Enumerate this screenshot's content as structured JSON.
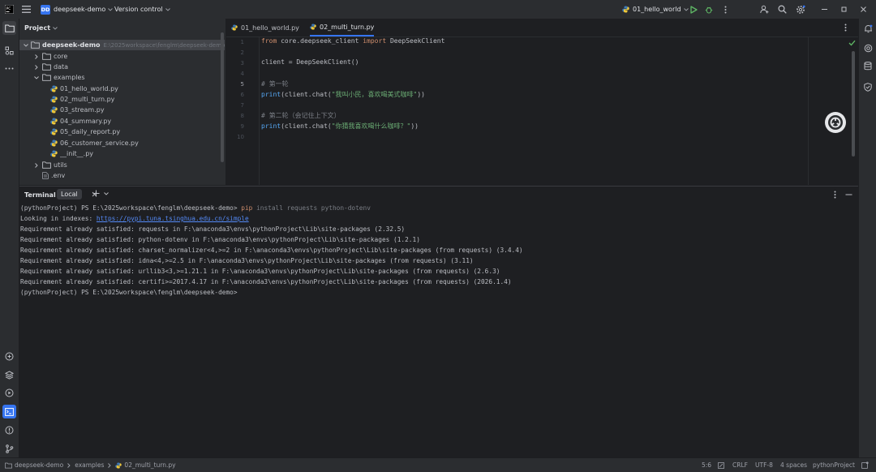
{
  "titlebar": {
    "project_badge": "DD",
    "project_name": "deepseek-demo",
    "version_control": "Version control",
    "run_config": "01_hello_world"
  },
  "project_panel": {
    "title": "Project",
    "root": {
      "name": "deepseek-demo",
      "path": "E:\\2025workspace\\fenglm\\deepseek-demo"
    },
    "items": [
      {
        "label": "core",
        "type": "folder",
        "depth": 1,
        "expanded": false
      },
      {
        "label": "data",
        "type": "folder",
        "depth": 1,
        "expanded": false
      },
      {
        "label": "examples",
        "type": "folder",
        "depth": 1,
        "expanded": true
      },
      {
        "label": "01_hello_world.py",
        "type": "py",
        "depth": 2
      },
      {
        "label": "02_multi_turn.py",
        "type": "py",
        "depth": 2
      },
      {
        "label": "03_stream.py",
        "type": "py",
        "depth": 2
      },
      {
        "label": "04_summary.py",
        "type": "py",
        "depth": 2
      },
      {
        "label": "05_daily_report.py",
        "type": "py",
        "depth": 2
      },
      {
        "label": "06_customer_service.py",
        "type": "py",
        "depth": 2
      },
      {
        "label": "__init__.py",
        "type": "py",
        "depth": 2
      },
      {
        "label": "utils",
        "type": "folder",
        "depth": 1,
        "expanded": false
      },
      {
        "label": ".env",
        "type": "file",
        "depth": 1
      }
    ]
  },
  "editor": {
    "tabs": [
      {
        "label": "01_hello_world.py",
        "active": false
      },
      {
        "label": "02_multi_turn.py",
        "active": true
      }
    ],
    "line_numbers": [
      "1",
      "2",
      "3",
      "4",
      "5",
      "6",
      "7",
      "8",
      "9",
      "10"
    ],
    "lines": [
      "from core.deepseek_client import DeepSeekClient",
      "",
      "client = DeepSeekClient()",
      "",
      "# 第一轮",
      "print(client.chat(\"我叫小民，喜欢喝美式咖啡\"))",
      "",
      "# 第二轮（会记住上下文）",
      "print(client.chat(\"你猜我喜欢喝什么咖啡？\"))",
      ""
    ]
  },
  "terminal": {
    "title": "Terminal",
    "tab": "Local",
    "prompt": "(pythonProject) PS E:\\2025workspace\\fenglm\\deepseek-demo>",
    "command_pip": "pip",
    "command_args": " install requests python-dotenv",
    "looking_prefix": "Looking in indexes: ",
    "looking_link": "https://pypi.tuna.tsinghua.edu.cn/simple",
    "output": [
      "Requirement already satisfied: requests in F:\\anaconda3\\envs\\pythonProject\\Lib\\site-packages (2.32.5)",
      "Requirement already satisfied: python-dotenv in F:\\anaconda3\\envs\\pythonProject\\Lib\\site-packages (1.2.1)",
      "Requirement already satisfied: charset_normalizer<4,>=2 in F:\\anaconda3\\envs\\pythonProject\\Lib\\site-packages (from requests) (3.4.4)",
      "Requirement already satisfied: idna<4,>=2.5 in F:\\anaconda3\\envs\\pythonProject\\Lib\\site-packages (from requests) (3.11)",
      "Requirement already satisfied: urllib3<3,>=1.21.1 in F:\\anaconda3\\envs\\pythonProject\\Lib\\site-packages (from requests) (2.6.3)",
      "Requirement already satisfied: certifi>=2017.4.17 in F:\\anaconda3\\envs\\pythonProject\\Lib\\site-packages (from requests) (2026.1.4)"
    ],
    "final_prompt": "(pythonProject) PS E:\\2025workspace\\fenglm\\deepseek-demo>"
  },
  "statusbar": {
    "crumb_project": "deepseek-demo",
    "crumb_folder": "examples",
    "crumb_file": "02_multi_turn.py",
    "position": "5:6",
    "line_ending": "CRLF",
    "encoding": "UTF-8",
    "indent": "4 spaces",
    "interpreter": "pythonProject"
  },
  "colors": {
    "accent": "#3574f0",
    "run_green": "#5fb865",
    "keyword": "#cf8e6d",
    "string": "#6aab73",
    "comment": "#7a7e85"
  }
}
